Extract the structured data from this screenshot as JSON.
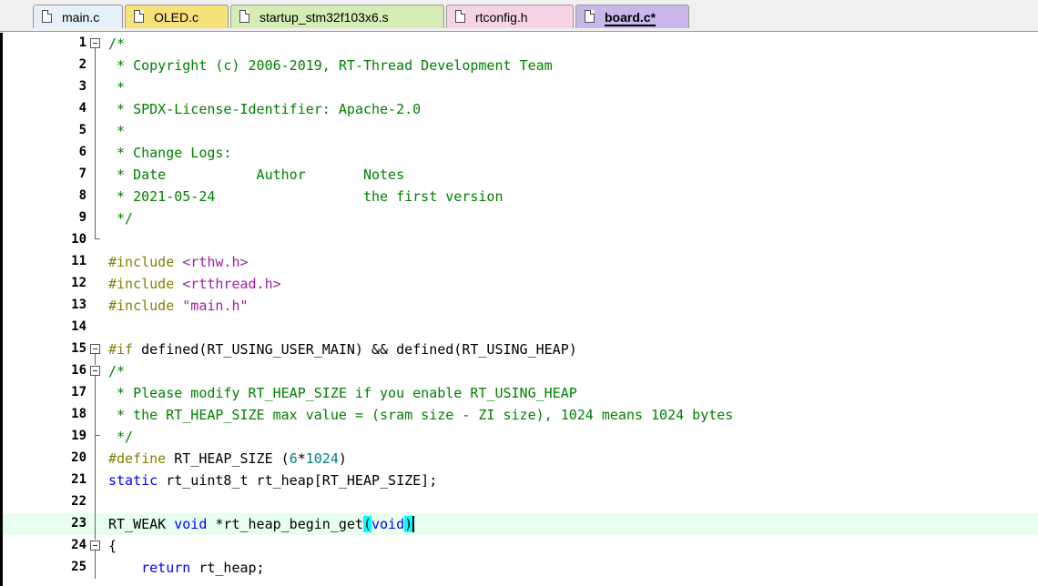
{
  "tabs": [
    {
      "label": "main.c",
      "color": "#e6f0fb",
      "active": false
    },
    {
      "label": "OLED.c",
      "color": "#f7e27a",
      "active": false
    },
    {
      "label": "startup_stm32f103x6.s",
      "color": "#d5ecb4",
      "active": false
    },
    {
      "label": "rtconfig.h",
      "color": "#f6d3e4",
      "active": false
    },
    {
      "label": "board.c*",
      "color": "#c9b6ea",
      "active": true
    }
  ],
  "editor": {
    "current_line": 23,
    "lines": [
      {
        "n": "1",
        "tokens": [
          [
            "cm",
            "/*"
          ]
        ]
      },
      {
        "n": "2",
        "tokens": [
          [
            "cm",
            " * Copyright (c) 2006-2019, RT-Thread Development Team"
          ]
        ]
      },
      {
        "n": "3",
        "tokens": [
          [
            "cm",
            " *"
          ]
        ]
      },
      {
        "n": "4",
        "tokens": [
          [
            "cm",
            " * SPDX-License-Identifier: Apache-2.0"
          ]
        ]
      },
      {
        "n": "5",
        "tokens": [
          [
            "cm",
            " *"
          ]
        ]
      },
      {
        "n": "6",
        "tokens": [
          [
            "cm",
            " * Change Logs:"
          ]
        ]
      },
      {
        "n": "7",
        "tokens": [
          [
            "cm",
            " * Date           Author       Notes"
          ]
        ]
      },
      {
        "n": "8",
        "tokens": [
          [
            "cm",
            " * 2021-05-24                  the first version"
          ]
        ]
      },
      {
        "n": "9",
        "tokens": [
          [
            "cm",
            " */"
          ]
        ]
      },
      {
        "n": "10",
        "tokens": []
      },
      {
        "n": "11",
        "tokens": [
          [
            "pp",
            "#include "
          ],
          [
            "str",
            "<rthw.h>"
          ]
        ]
      },
      {
        "n": "12",
        "tokens": [
          [
            "pp",
            "#include "
          ],
          [
            "str",
            "<rtthread.h>"
          ]
        ]
      },
      {
        "n": "13",
        "tokens": [
          [
            "pp",
            "#include "
          ],
          [
            "str",
            "\"main.h\""
          ]
        ]
      },
      {
        "n": "14",
        "tokens": []
      },
      {
        "n": "15",
        "tokens": [
          [
            "pp",
            "#if "
          ],
          [
            "",
            "defined(RT_USING_USER_MAIN) && defined(RT_USING_HEAP)"
          ]
        ]
      },
      {
        "n": "16",
        "tokens": [
          [
            "cm",
            "/*"
          ]
        ]
      },
      {
        "n": "17",
        "tokens": [
          [
            "cm",
            " * Please modify RT_HEAP_SIZE if you enable RT_USING_HEAP"
          ]
        ]
      },
      {
        "n": "18",
        "tokens": [
          [
            "cm",
            " * the RT_HEAP_SIZE max value = (sram size - ZI size), 1024 means 1024 bytes"
          ]
        ]
      },
      {
        "n": "19",
        "tokens": [
          [
            "cm",
            " */"
          ]
        ]
      },
      {
        "n": "20",
        "tokens": [
          [
            "pp",
            "#define "
          ],
          [
            "",
            "RT_HEAP_SIZE "
          ],
          [
            "",
            "("
          ],
          [
            "num",
            "6"
          ],
          [
            "",
            "*"
          ],
          [
            "num",
            "1024"
          ],
          [
            "",
            ")"
          ]
        ]
      },
      {
        "n": "21",
        "tokens": [
          [
            "kw",
            "static "
          ],
          [
            "",
            "rt_uint8_t rt_heap[RT_HEAP_SIZE];"
          ]
        ]
      },
      {
        "n": "22",
        "tokens": []
      },
      {
        "n": "23",
        "tokens": [
          [
            "",
            "RT_WEAK "
          ],
          [
            "kw",
            "void "
          ],
          [
            "",
            "*rt_heap_begin_get"
          ],
          [
            "hl",
            "("
          ],
          [
            "kw",
            "void"
          ],
          [
            "hl",
            ")"
          ]
        ]
      },
      {
        "n": "24",
        "tokens": [
          [
            "",
            "{"
          ]
        ]
      },
      {
        "n": "25",
        "tokens": [
          [
            "",
            "    "
          ],
          [
            "kw",
            "return "
          ],
          [
            "",
            "rt_heap;"
          ]
        ]
      }
    ]
  }
}
